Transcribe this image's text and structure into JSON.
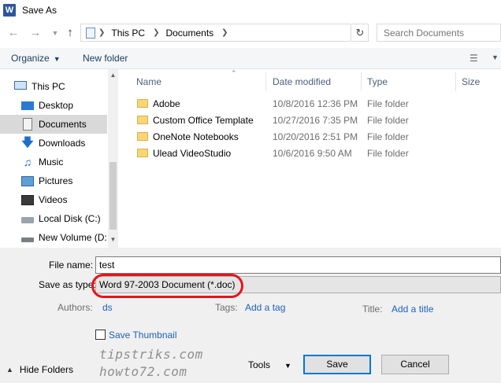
{
  "window": {
    "title": "Save As",
    "app_icon_letter": "W"
  },
  "address_bar": {
    "crumbs": [
      "This PC",
      "Documents"
    ],
    "search_placeholder": "Search Documents"
  },
  "toolbar": {
    "organize_label": "Organize",
    "new_folder_label": "New folder"
  },
  "nav_pane": {
    "items": [
      {
        "label": "This PC",
        "icon": "pc-icon"
      },
      {
        "label": "Desktop",
        "icon": "desktop-icon"
      },
      {
        "label": "Documents",
        "icon": "documents-icon",
        "selected": true
      },
      {
        "label": "Downloads",
        "icon": "downloads-icon"
      },
      {
        "label": "Music",
        "icon": "music-icon"
      },
      {
        "label": "Pictures",
        "icon": "pictures-icon"
      },
      {
        "label": "Videos",
        "icon": "videos-icon"
      },
      {
        "label": "Local Disk (C:)",
        "icon": "local-disk-icon"
      },
      {
        "label": "New Volume (D:",
        "icon": "volume-icon"
      }
    ]
  },
  "file_list": {
    "columns": [
      "Name",
      "Date modified",
      "Type",
      "Size"
    ],
    "rows": [
      {
        "name": "Adobe",
        "date": "10/8/2016 12:36 PM",
        "type": "File folder"
      },
      {
        "name": "Custom Office Template",
        "date": "10/27/2016 7:35 PM",
        "type": "File folder"
      },
      {
        "name": "OneNote Notebooks",
        "date": "10/20/2016 2:51 PM",
        "type": "File folder"
      },
      {
        "name": "Ulead VideoStudio",
        "date": "10/6/2016 9:50 AM",
        "type": "File folder"
      }
    ]
  },
  "save_form": {
    "file_name_label": "File name:",
    "file_name_value": "test",
    "save_as_type_label": "Save as type:",
    "save_as_type_value": "Word 97-2003 Document (*.doc)",
    "authors_label": "Authors:",
    "authors_value": "ds",
    "tags_label": "Tags:",
    "tags_link": "Add a tag",
    "title_label": "Title:",
    "title_link": "Add a title",
    "thumbnail_label": "Save Thumbnail",
    "hide_folders_label": "Hide Folders",
    "tools_label": "Tools",
    "save_button": "Save",
    "cancel_button": "Cancel"
  },
  "watermark": {
    "line1": "tipstriks.com",
    "line2": "howto72.com"
  },
  "colors": {
    "accent": "#0078d7",
    "link": "#1c62b9",
    "highlight_circle": "#e8141a",
    "folder": "#f7d675"
  }
}
